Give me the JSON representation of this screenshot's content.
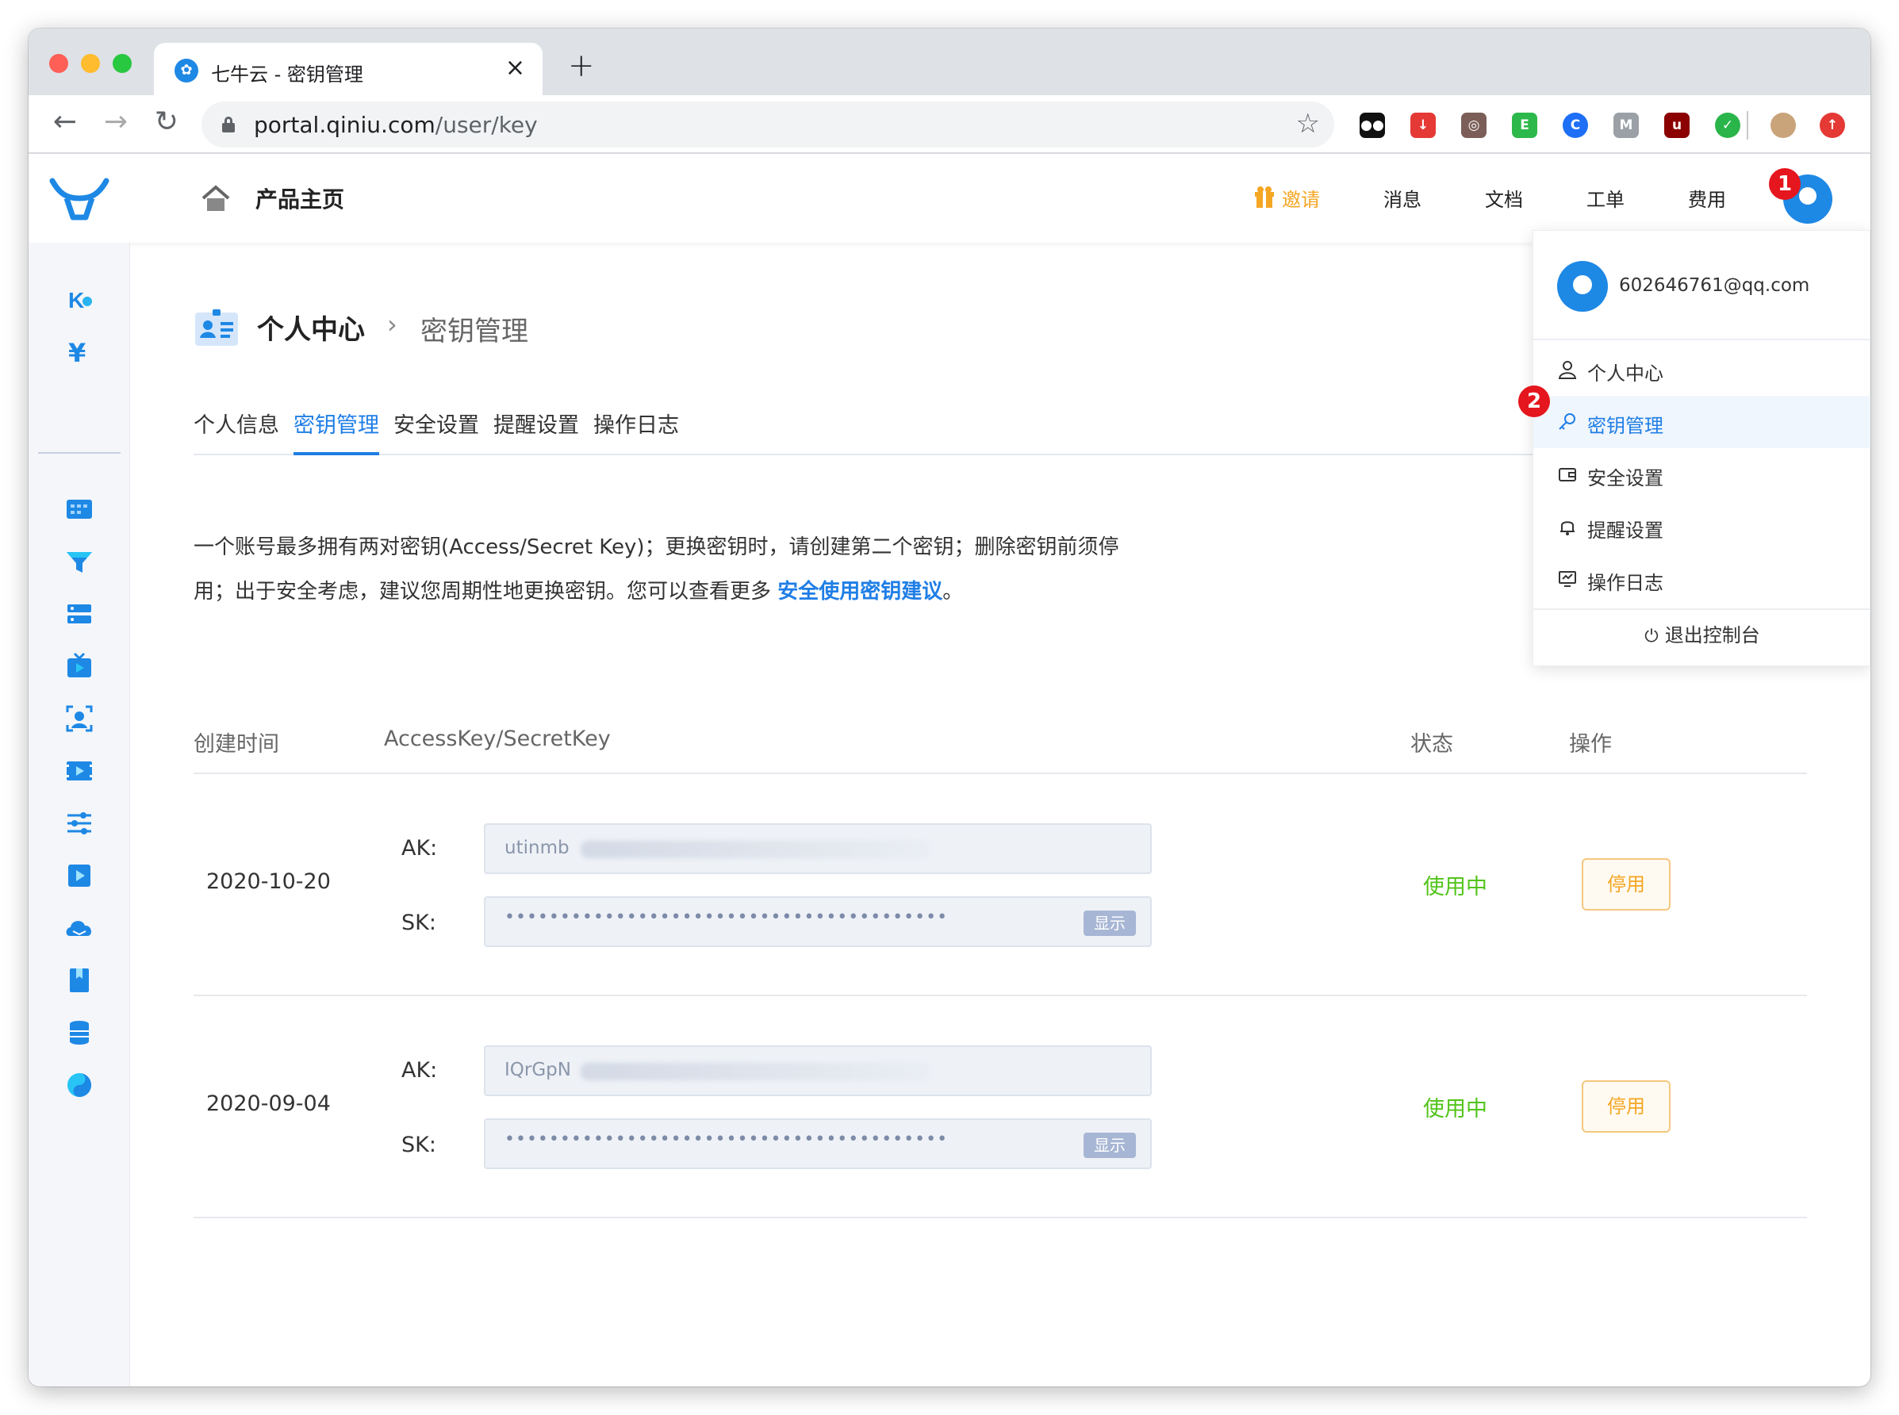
{
  "browser": {
    "tab_title": "七牛云 - 密钥管理",
    "tab_close": "×",
    "new_tab": "+",
    "url_host": "portal.qiniu.com",
    "url_path": "/user/key"
  },
  "header": {
    "home_label": "产品主页",
    "invite": "邀请",
    "messages": "消息",
    "docs": "文档",
    "tickets": "工单",
    "billing": "费用",
    "badge_1": "1"
  },
  "breadcrumb": {
    "main": "个人中心",
    "sep": "›",
    "sub": "密钥管理"
  },
  "tabs": [
    {
      "label": "个人信息"
    },
    {
      "label": "密钥管理"
    },
    {
      "label": "安全设置"
    },
    {
      "label": "提醒设置"
    },
    {
      "label": "操作日志"
    }
  ],
  "description": {
    "line1": "一个账号最多拥有两对密钥(Access/Secret Key)；更换密钥时，请创建第二个密钥；删除密钥前须停",
    "line2_prefix": "用；出于安全考虑，建议您周期性地更换密钥。您可以查看更多 ",
    "link": "安全使用密钥建议",
    "line2_suffix": "。"
  },
  "table": {
    "columns": [
      "创建时间",
      "AccessKey/SecretKey",
      "状态",
      "操作"
    ],
    "rows": [
      {
        "created": "2020-10-20",
        "ak_label": "AK:",
        "ak_value": "utinmb",
        "sk_label": "SK:",
        "sk_value": "••••••••••••••••••••••••••••••••••••••••",
        "show": "显示",
        "status": "使用中",
        "action": "停用"
      },
      {
        "created": "2020-09-04",
        "ak_label": "AK:",
        "ak_value": "IQrGpN",
        "sk_label": "SK:",
        "sk_value": "••••••••••••••••••••••••••••••••••••••••",
        "show": "显示",
        "status": "使用中",
        "action": "停用"
      }
    ]
  },
  "dropdown": {
    "email": "602646761@qq.com",
    "badge_2": "2",
    "items": [
      {
        "label": "个人中心",
        "icon": "user-icon"
      },
      {
        "label": "密钥管理",
        "icon": "key-icon"
      },
      {
        "label": "安全设置",
        "icon": "wallet-icon"
      },
      {
        "label": "提醒设置",
        "icon": "bell-icon"
      },
      {
        "label": "操作日志",
        "icon": "log-icon"
      }
    ],
    "logout": "退出控制台"
  },
  "colors": {
    "accent": "#1f7ee6",
    "invite": "#f5a623",
    "status_active": "#52c41a",
    "badge": "#e5161d"
  }
}
